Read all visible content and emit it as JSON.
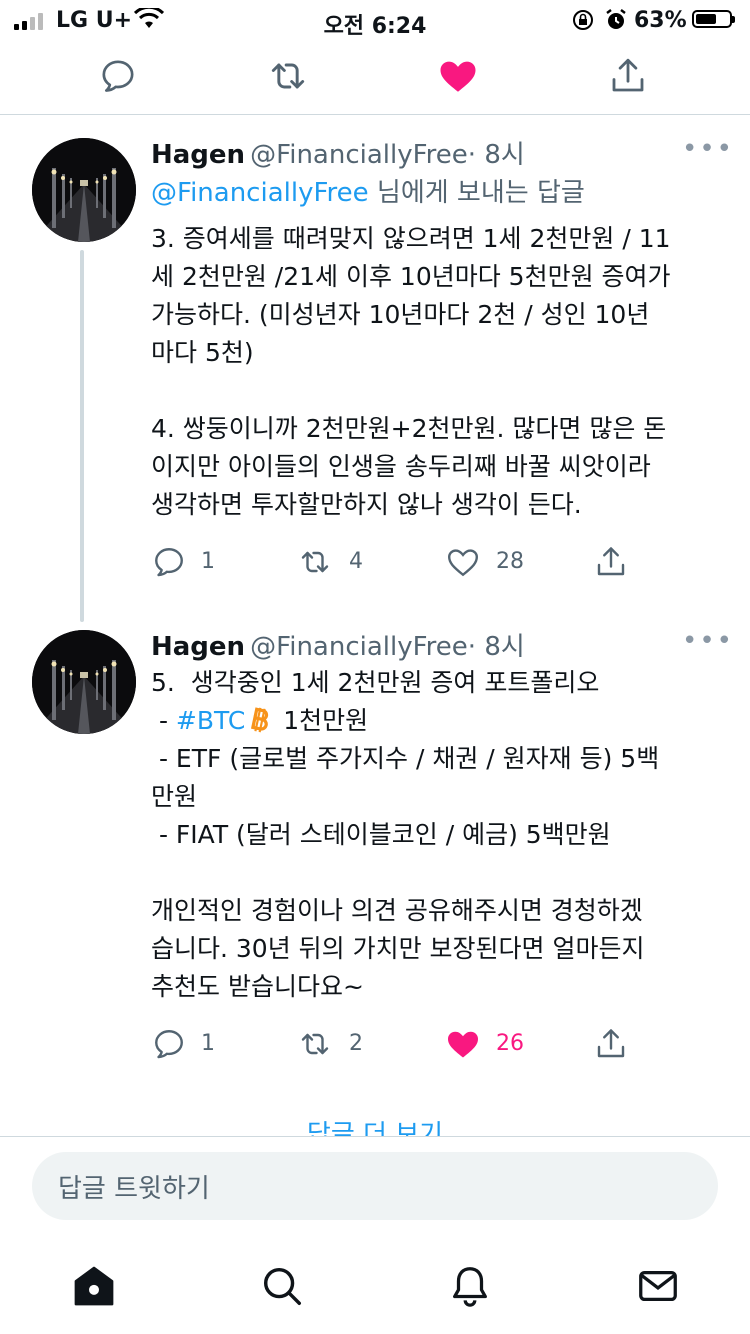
{
  "status_bar": {
    "carrier": "LG U+",
    "time": "오전 6:24",
    "battery": "63%",
    "battery_level": 0.63
  },
  "tweets": [
    {
      "name": "Hagen",
      "handle": "@FinanciallyFree",
      "time": "· 8시",
      "reply_to_handle": "@FinanciallyFree",
      "reply_to_suffix": " 님에게 보내는 답글",
      "text": "3. 증여세를 때려맞지 않으려면 1세 2천만원 / 11\n세 2천만원 /21세 이후 10년마다 5천만원 증여가\n가능하다. (미성년자 10년마다 2천 / 성인 10년\n마다 5천)\n\n4. 쌍둥이니까 2천만원+2천만원. 많다면 많은 돈\n이지만 아이들의 인생을 송두리째 바꿀 씨앗이라\n생각하면 투자할만하지 않나 생각이 든다.",
      "replies": "1",
      "retweets": "4",
      "likes": "28"
    },
    {
      "name": "Hagen",
      "handle": "@FinanciallyFree",
      "time": "· 8시",
      "line1": "5.  생각중인 1세 2천만원 증여 포트폴리오",
      "btc_prefix": " - ",
      "btc_tag": "#BTC",
      "btc_suffix": " 1천만원",
      "rest": " - ETF (글로벌 주가지수 / 채권 / 원자재 등) 5백\n만원\n - FIAT (달러 스테이블코인 / 예금) 5백만원\n\n개인적인 경험이나 의견 공유해주시면 경청하겠\n습니다. 30년 뒤의 가치만 보장된다면 얼마든지\n추천도 받습니다요~",
      "replies": "1",
      "retweets": "2",
      "likes": "26"
    }
  ],
  "more_replies": "답글 더 보기",
  "reply_placeholder": "답글 트윗하기",
  "icons": {
    "top": [
      "reply-icon",
      "retweet-icon",
      "like-filled-icon",
      "share-icon"
    ],
    "tabs": [
      "home-icon",
      "search-icon",
      "notifications-icon",
      "messages-icon"
    ]
  },
  "colors": {
    "like": "#f91880",
    "link": "#1d9bf0",
    "btc": "#f7931a"
  }
}
